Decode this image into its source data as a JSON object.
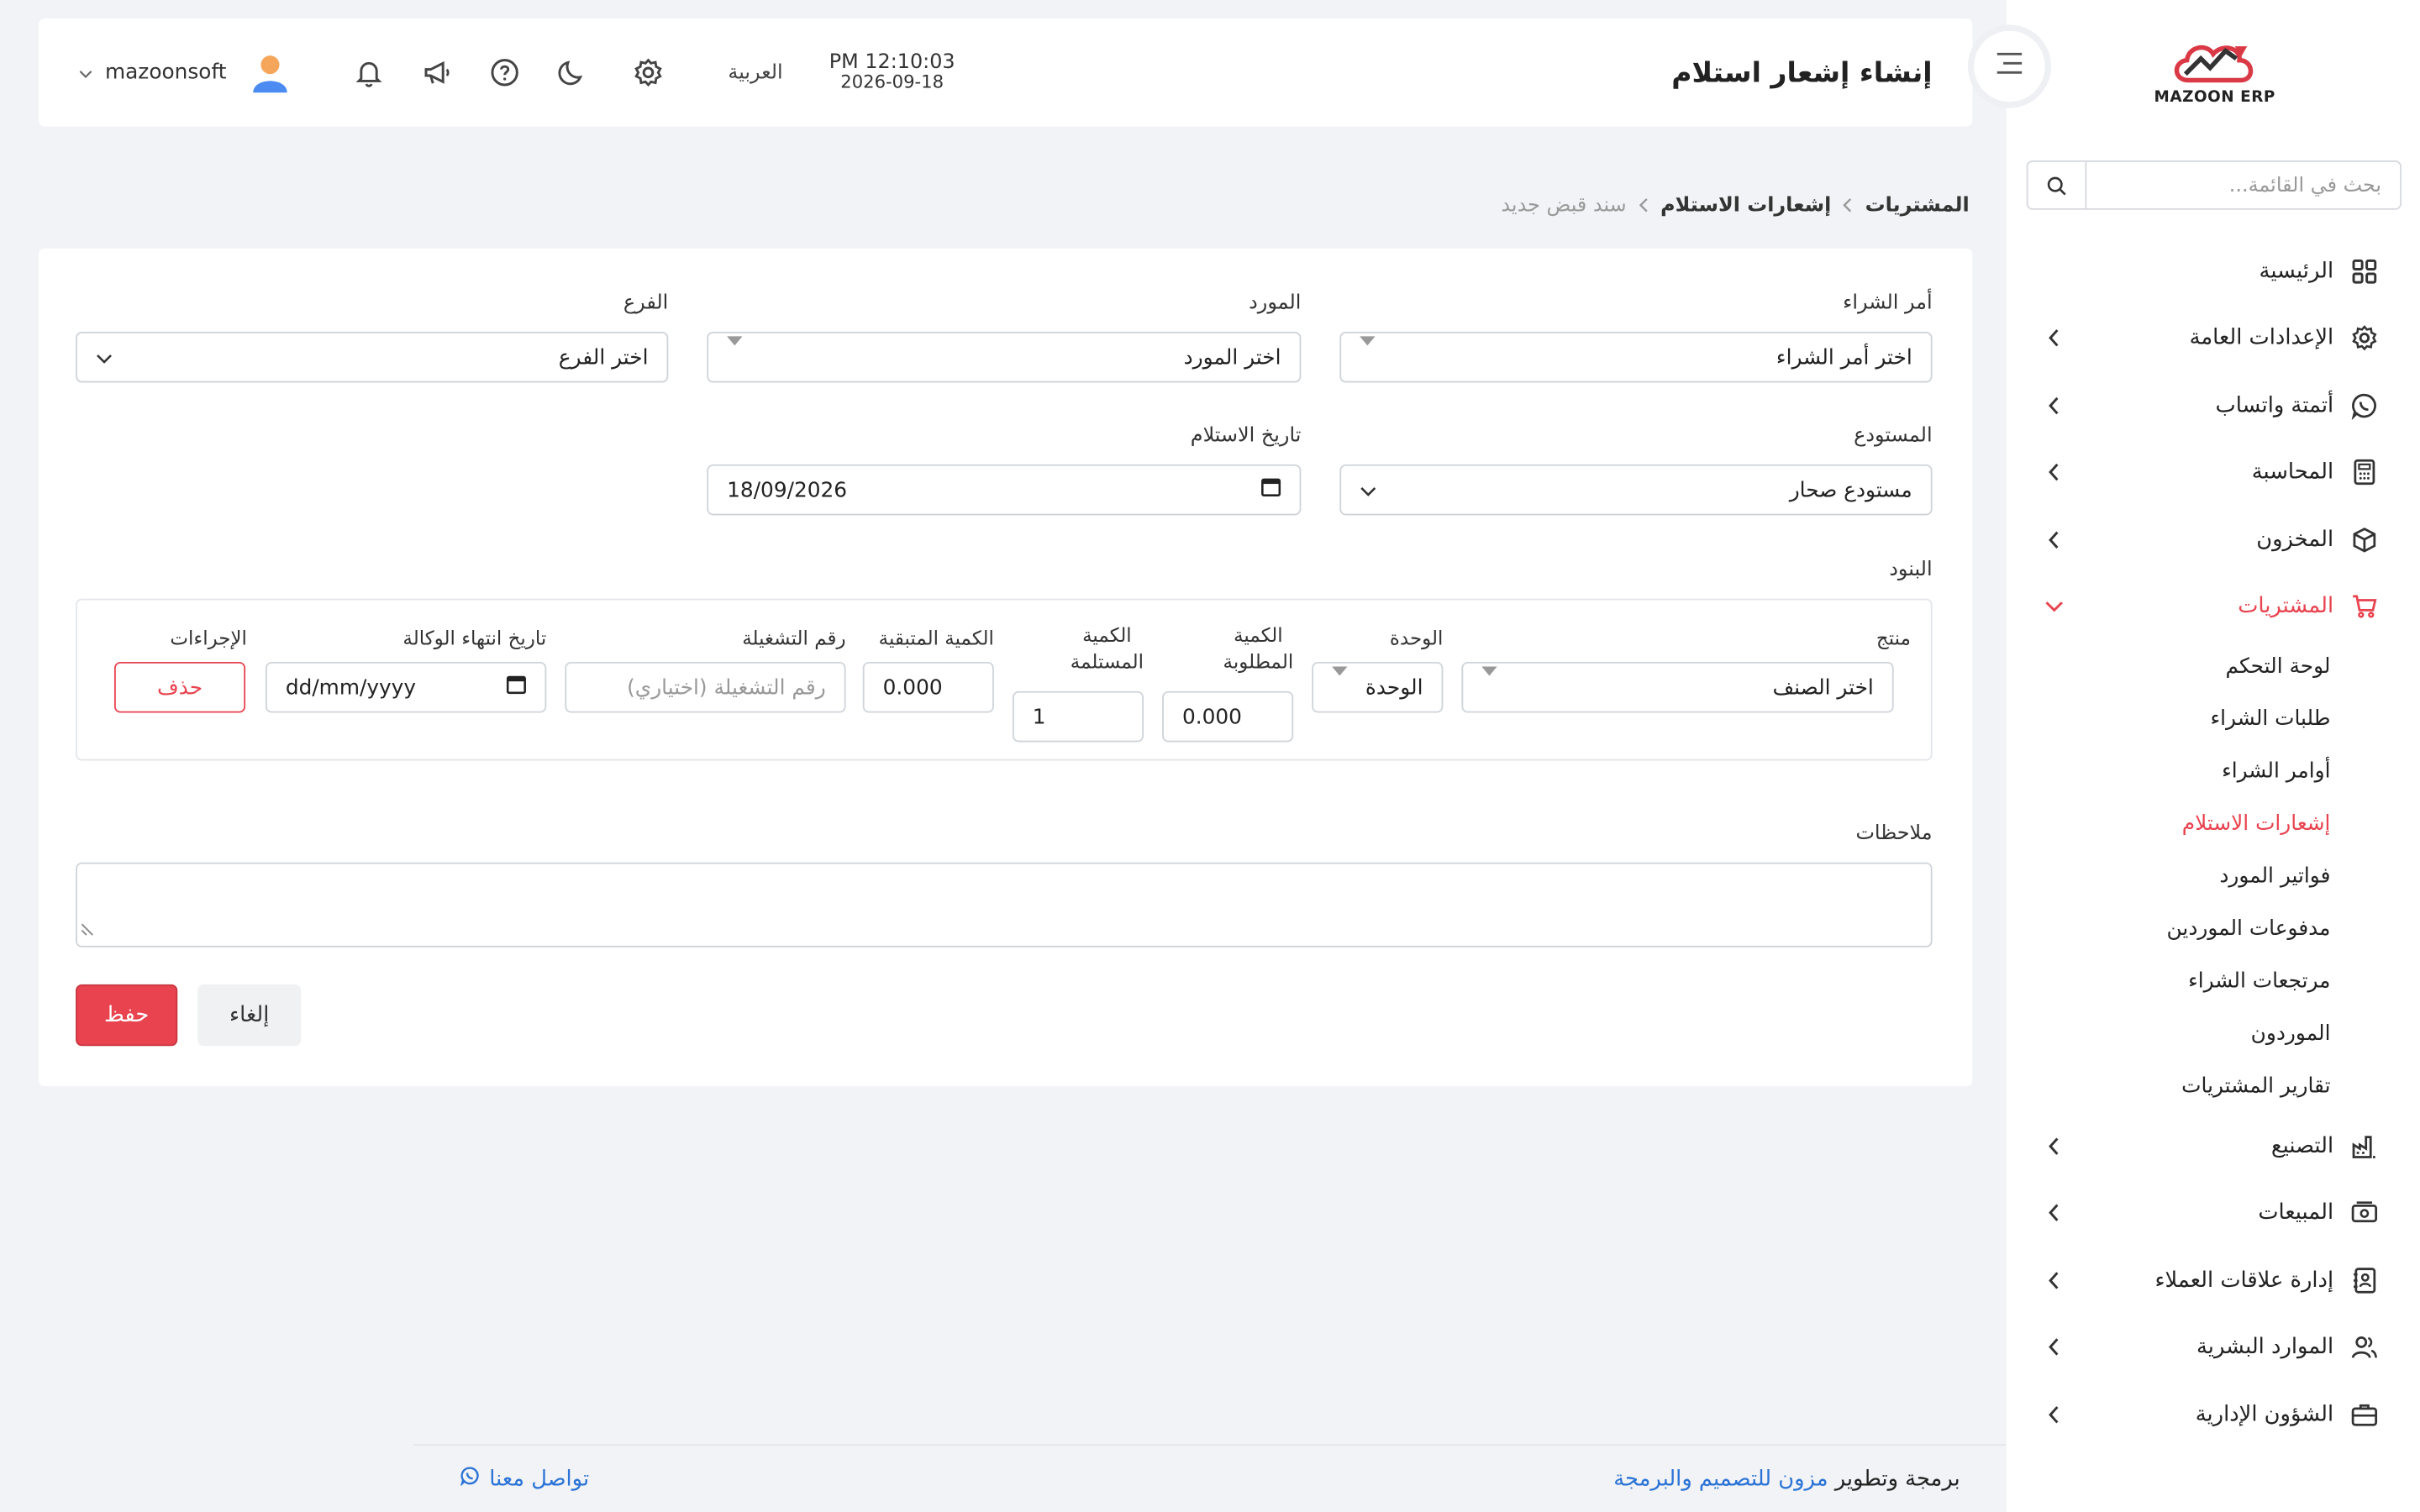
{
  "sidebar": {
    "logo_text": "MAZOON ERP",
    "search_placeholder": "بحث في القائمة...",
    "items": [
      {
        "label": "الرئيسية",
        "icon": "grid-icon"
      },
      {
        "label": "الإعدادات العامة",
        "icon": "gear-icon"
      },
      {
        "label": "أتمتة واتساب",
        "icon": "whatsapp-icon"
      },
      {
        "label": "المحاسبة",
        "icon": "calculator-icon"
      },
      {
        "label": "المخزون",
        "icon": "box-icon"
      },
      {
        "label": "المشتريات",
        "icon": "cart-icon"
      },
      {
        "label": "التصنيع",
        "icon": "factory-icon"
      },
      {
        "label": "المبيعات",
        "icon": "cash-icon"
      },
      {
        "label": "إدارة علاقات العملاء",
        "icon": "contacts-icon"
      },
      {
        "label": "الموارد البشرية",
        "icon": "users-icon"
      },
      {
        "label": "الشؤون الإدارية",
        "icon": "briefcase-icon"
      }
    ],
    "purchases_sub": [
      "لوحة التحكم",
      "طلبات الشراء",
      "أوامر الشراء",
      "إشعارات الاستلام",
      "فواتير المورد",
      "مدفوعات الموردين",
      "مرتجعات الشراء",
      "الموردون",
      "تقارير المشتريات"
    ],
    "accent_color": "#e8434f"
  },
  "header": {
    "title": "إنشاء إشعار استلام",
    "time": "PM 12:10:03",
    "date": "2026-09-18",
    "language": "العربية",
    "username": "mazoonsoft"
  },
  "breadcrumb": {
    "root": "المشتريات",
    "parent": "إشعارات الاستلام",
    "current": "سند قبض جديد"
  },
  "form": {
    "po_label": "أمر الشراء",
    "po_value": "اختر أمر الشراء",
    "supplier_label": "المورد",
    "supplier_value": "اختر المورد",
    "branch_label": "الفرع",
    "branch_value": "اختر الفرع",
    "warehouse_label": "المستودع",
    "warehouse_value": "مستودع صحار",
    "date_label": "تاريخ الاستلام",
    "date_value": "18/09/2026",
    "items_label": "البنود",
    "notes_label": "ملاحظات"
  },
  "items_table": {
    "headers": {
      "product": "منتج",
      "unit": "الوحدة",
      "qty_required_1": "الكمية",
      "qty_required_2": "المطلوبة",
      "qty_received_1": "الكمية",
      "qty_received_2": "المستلمة",
      "qty_remaining": "الكمية المتبقية",
      "batch": "رقم التشغيلة",
      "expiry": "تاريخ انتهاء الوكالة",
      "actions": "الإجراءات"
    },
    "row": {
      "product": "اختر الصنف",
      "unit": "الوحدة",
      "qty_required": "0.000",
      "qty_received": "1",
      "qty_remaining": "0.000",
      "batch_placeholder": "رقم التشغيلة (اختياري)",
      "expiry": "dd/mm/yyyy",
      "delete": "حذف"
    }
  },
  "buttons": {
    "save": "حفظ",
    "cancel": "إلغاء"
  },
  "footer": {
    "credit_prefix": "برمجة وتطوير",
    "credit_link": "مزون للتصميم والبرمجة",
    "contact": "تواصل معنا"
  }
}
